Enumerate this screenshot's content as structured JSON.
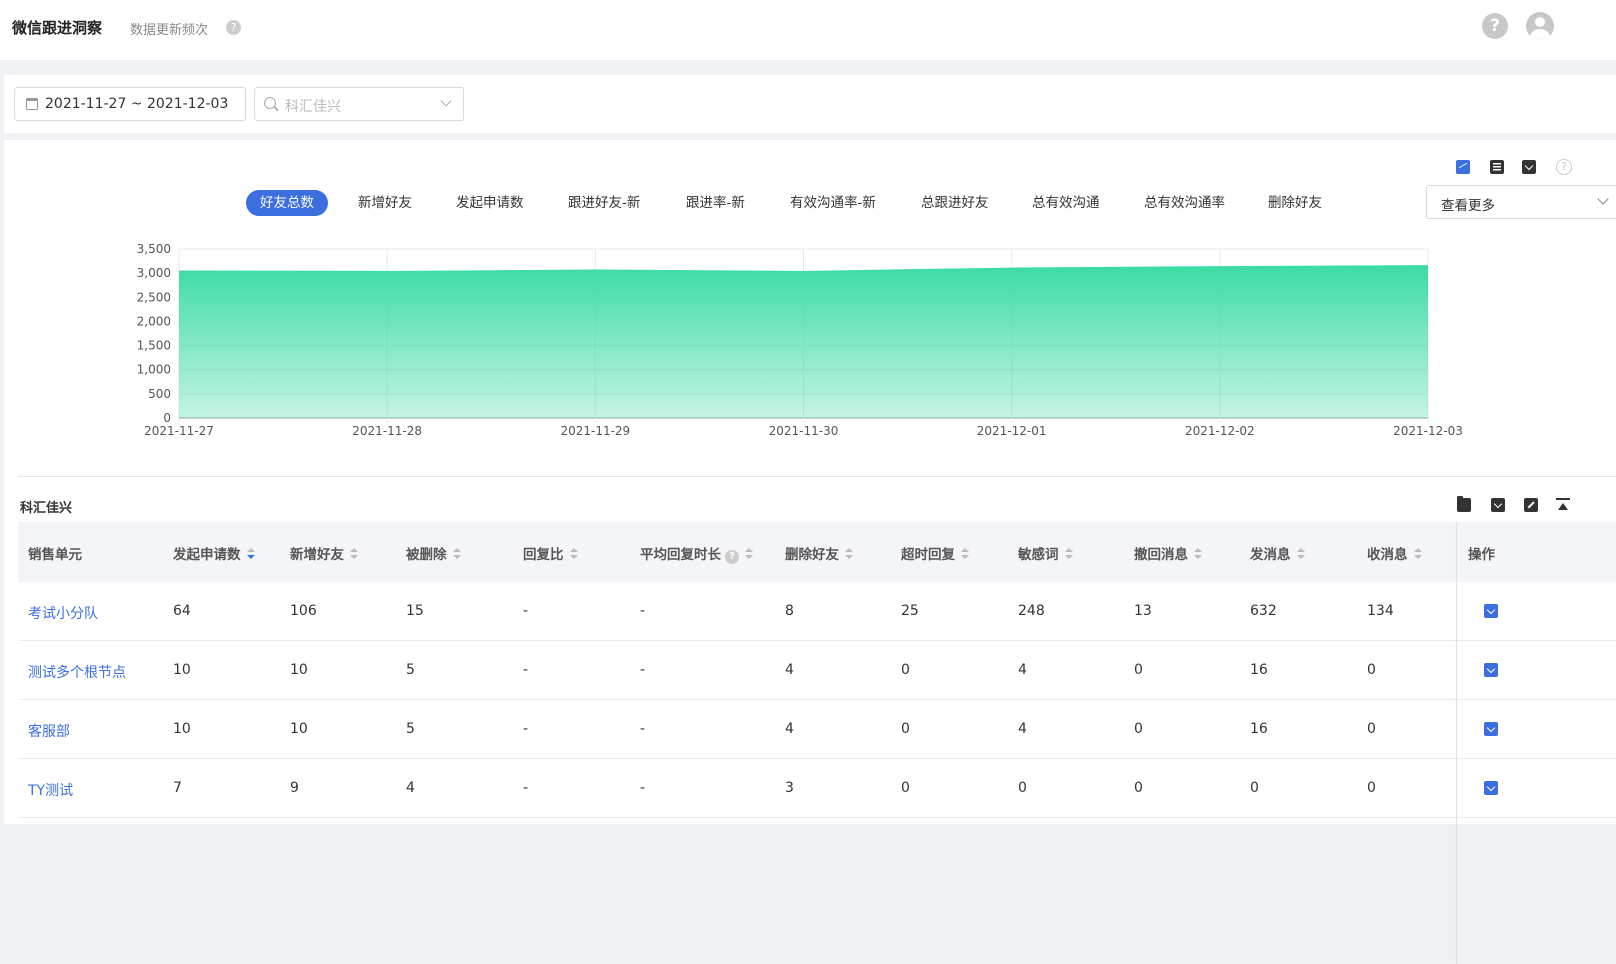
{
  "header": {
    "title": "微信跟进洞察",
    "update_frequency": "数据更新频次",
    "help_glyph": "?"
  },
  "filters": {
    "date_range": "2021-11-27 ~ 2021-12-03",
    "org_placeholder": "科汇佳兴"
  },
  "chart_panel": {
    "tabs": [
      "好友总数",
      "新增好友",
      "发起申请数",
      "跟进好友-新",
      "跟进率-新",
      "有效沟通率-新",
      "总跟进好友",
      "总有效沟通",
      "总有效沟通率",
      "删除好友"
    ],
    "active_tab": 0,
    "more_label": "查看更多",
    "help_glyph": "?"
  },
  "chart_data": {
    "type": "area",
    "x": [
      "2021-11-27",
      "2021-11-28",
      "2021-11-29",
      "2021-11-30",
      "2021-12-01",
      "2021-12-02",
      "2021-12-03"
    ],
    "series": [
      {
        "values": [
          3040,
          3030,
          3060,
          3030,
          3100,
          3130,
          3150
        ]
      }
    ],
    "ylim": [
      0,
      3500
    ],
    "yticks": [
      "0",
      "500",
      "1,000",
      "1,500",
      "2,000",
      "2,500",
      "3,000",
      "3,500"
    ],
    "grid": true,
    "color": "#3ddba6"
  },
  "table": {
    "title": "科汇佳兴",
    "columns": [
      "销售单元",
      "发起申请数",
      "新增好友",
      "被删除",
      "回复比",
      "平均回复时长",
      "删除好友",
      "超时回复",
      "敏感词",
      "撤回消息",
      "发消息",
      "收消息",
      "操作"
    ],
    "rows": [
      [
        "考试小分队",
        "64",
        "106",
        "15",
        "-",
        "-",
        "8",
        "25",
        "248",
        "13",
        "632",
        "134"
      ],
      [
        "测试多个根节点",
        "10",
        "10",
        "5",
        "-",
        "-",
        "4",
        "0",
        "4",
        "0",
        "16",
        "0"
      ],
      [
        "客服部",
        "10",
        "10",
        "5",
        "-",
        "-",
        "4",
        "0",
        "4",
        "0",
        "16",
        "0"
      ],
      [
        "TY测试",
        "7",
        "9",
        "4",
        "-",
        "-",
        "3",
        "0",
        "0",
        "0",
        "0",
        "0"
      ]
    ]
  }
}
